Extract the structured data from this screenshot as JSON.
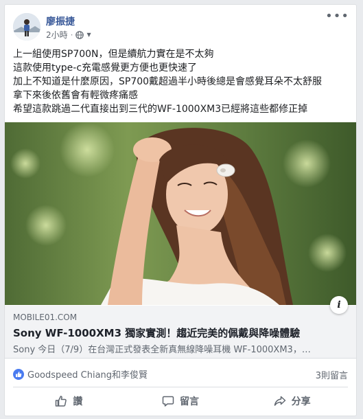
{
  "post": {
    "author": "廖振捷",
    "time": "2小時",
    "separator": "·",
    "privacy_icon": "globe-icon",
    "more_icon": "•••",
    "text_lines": [
      "上一組使用SP700N，但是續航力實在是不太夠",
      "這款使用type-c充電感覺更方便也更快速了",
      "加上不知道是什麼原因，SP700戴超過半小時後總是會感覺耳朵不太舒服",
      "拿下來後依舊會有輕微疼痛感",
      "希望這款跳過二代直接出到三代的WF-1000XM3已經將這些都修正掉"
    ]
  },
  "link": {
    "info_icon": "i",
    "domain": "MOBILE01.COM",
    "title": "Sony WF-1000XM3 獨家實測！趨近完美的佩戴與降噪體驗",
    "description": "Sony 今日（7/9）在台灣正式發表全新真無線降噪耳機 WF-1000XM3，…"
  },
  "reactions": {
    "names": "Goodspeed Chiang和李俊賢",
    "comments": "3則留言",
    "like_color": "#4a7bf0"
  },
  "actions": {
    "like": "讚",
    "comment": "留言",
    "share": "分享"
  }
}
